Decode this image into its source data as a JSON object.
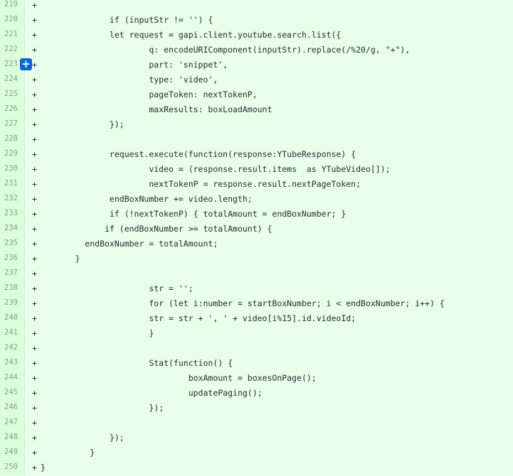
{
  "diff": {
    "sign": "+",
    "add_comment_icon": "+",
    "lines": [
      {
        "num": "219",
        "code": ""
      },
      {
        "num": "220",
        "code": "              if (inputStr != '') {"
      },
      {
        "num": "221",
        "code": "              let request = gapi.client.youtube.search.list({"
      },
      {
        "num": "222",
        "code": "                      q: encodeURIComponent(inputStr).replace(/%20/g, \"+\"),"
      },
      {
        "num": "223",
        "code": "                      part: 'snippet',"
      },
      {
        "num": "224",
        "code": "                      type: 'video',"
      },
      {
        "num": "225",
        "code": "                      pageToken: nextTokenP,"
      },
      {
        "num": "226",
        "code": "                      maxResults: boxLoadAmount"
      },
      {
        "num": "227",
        "code": "              });"
      },
      {
        "num": "228",
        "code": ""
      },
      {
        "num": "229",
        "code": "              request.execute(function(response:YTubeResponse) {"
      },
      {
        "num": "230",
        "code": "                      video = (response.result.items  as YTubeVideo[]);"
      },
      {
        "num": "231",
        "code": "                      nextTokenP = response.result.nextPageToken;"
      },
      {
        "num": "232",
        "code": "              endBoxNumber += video.length;"
      },
      {
        "num": "233",
        "code": "              if (!nextTokenP) { totalAmount = endBoxNumber; }"
      },
      {
        "num": "234",
        "code": "             if (endBoxNumber >= totalAmount) {"
      },
      {
        "num": "235",
        "code": "         endBoxNumber = totalAmount;"
      },
      {
        "num": "236",
        "code": "       }"
      },
      {
        "num": "237",
        "code": ""
      },
      {
        "num": "238",
        "code": "                      str = '';"
      },
      {
        "num": "239",
        "code": "                      for (let i:number = startBoxNumber; i < endBoxNumber; i++) {"
      },
      {
        "num": "240",
        "code": "                      str = str + ', ' + video[i%15].id.videoId;"
      },
      {
        "num": "241",
        "code": "                      }"
      },
      {
        "num": "242",
        "code": ""
      },
      {
        "num": "243",
        "code": "                      Stat(function() {"
      },
      {
        "num": "244",
        "code": "                              boxAmount = boxesOnPage();"
      },
      {
        "num": "245",
        "code": "                              updatePaging();"
      },
      {
        "num": "246",
        "code": "                      });"
      },
      {
        "num": "247",
        "code": ""
      },
      {
        "num": "248",
        "code": "              });"
      },
      {
        "num": "249",
        "code": "          }"
      },
      {
        "num": "250",
        "code": "}"
      }
    ]
  }
}
